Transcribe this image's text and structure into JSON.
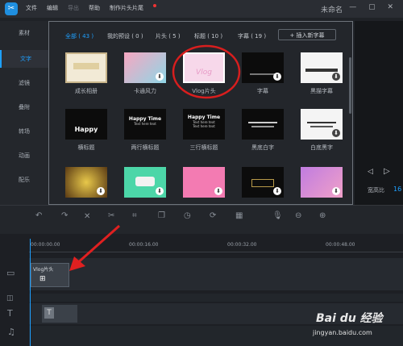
{
  "menu": {
    "items": [
      "文件",
      "编辑",
      "导出",
      "帮助",
      "制作片头片尾"
    ],
    "project_title": "未命名",
    "window_controls": "— ▢ ✕"
  },
  "left_nav": {
    "items": [
      "素材",
      "文字",
      "滤镜",
      "叠附",
      "转场",
      "动画",
      "配乐"
    ],
    "active_index": 1
  },
  "library": {
    "filters": [
      "全部 ( 43 )",
      "我的预设 ( 0 )",
      "片头 ( 5 )",
      "标题 ( 10 )",
      "字幕 ( 19 )"
    ],
    "active_filter_index": 0,
    "insert_button": "+ 插入新字幕",
    "items": [
      {
        "caption": "成长相册"
      },
      {
        "caption": "卡通风力"
      },
      {
        "caption": "Vlog片头",
        "thumb_text": "Vlog"
      },
      {
        "caption": "字幕"
      },
      {
        "caption": "黑描字幕"
      },
      {
        "caption": "横标题",
        "thumb_text": "Happy Time"
      },
      {
        "caption": "两行横标题",
        "thumb_text": "Happy Time",
        "thumb_subtext": "Text here text"
      },
      {
        "caption": "三行横标题",
        "thumb_text": "Happy Time",
        "thumb_subtext": "Text here text"
      },
      {
        "caption": "黑底白字"
      },
      {
        "caption": "白底黑字"
      },
      {
        "caption": ""
      },
      {
        "caption": ""
      },
      {
        "caption": ""
      },
      {
        "caption": ""
      },
      {
        "caption": ""
      }
    ]
  },
  "preview": {
    "ratio_label": "宽高比",
    "ratio_value": "16"
  },
  "timeline": {
    "ticks": [
      "00:00:00.00",
      "00:00:16.00",
      "00:00:32.00",
      "00:00:48.00"
    ],
    "clip_label": "Vlog片头",
    "text_track_mark": "T"
  },
  "watermark": {
    "brand": "Bai du 经验",
    "url": "jingyan.baidu.com"
  },
  "colors": {
    "accent": "#1ea0ff",
    "highlight_ring": "#d81e1e",
    "arrow": "#e02020"
  }
}
